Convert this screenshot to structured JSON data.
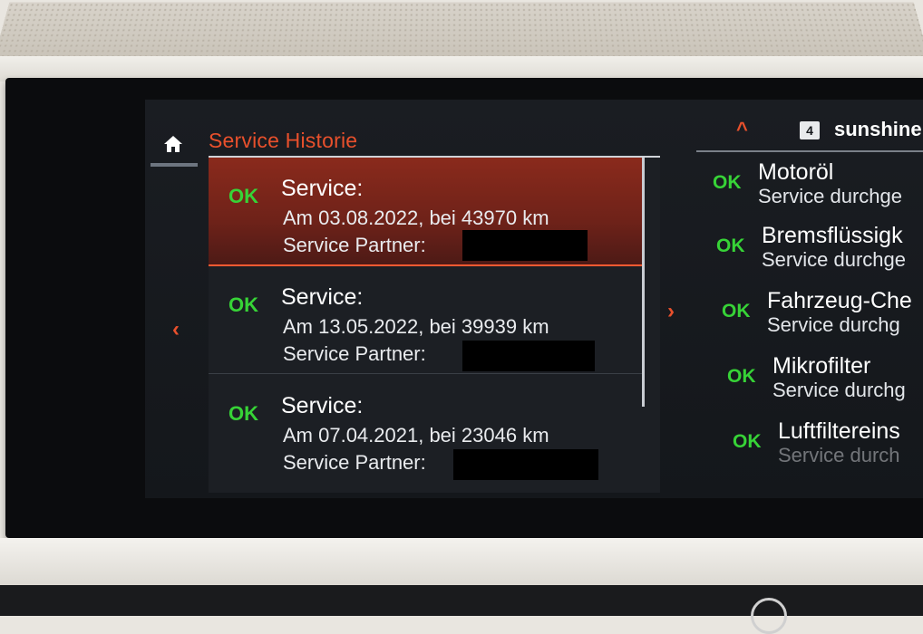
{
  "screen": {
    "panel_title": "Service Historie",
    "nav_left": "‹",
    "nav_right": "›",
    "up_chevron": "^",
    "profile_number": "4",
    "profile_name": "sunshine",
    "history": [
      {
        "status": "OK",
        "title": "Service:",
        "detail": "Am 03.08.2022, bei 43970 km",
        "partner_label": "Service Partner: ",
        "selected": true
      },
      {
        "status": "OK",
        "title": "Service:",
        "detail": "Am 13.05.2022, bei 39939 km",
        "partner_label": "Service Partner: ",
        "selected": false
      },
      {
        "status": "OK",
        "title": "Service:",
        "detail": "Am 07.04.2021, bei 23046 km",
        "partner_label": "Service Partner:",
        "selected": false
      }
    ],
    "checks": [
      {
        "status": "OK",
        "name": "Motoröl",
        "status_text": "Service durchge"
      },
      {
        "status": "OK",
        "name": "Bremsflüssigk",
        "status_text": "Service durchge"
      },
      {
        "status": "OK",
        "name": "Fahrzeug-Che",
        "status_text": "Service durchg"
      },
      {
        "status": "OK",
        "name": "Mikrofilter",
        "status_text": "Service durchg"
      },
      {
        "status": "OK",
        "name": "Luftfiltereins",
        "status_text": "Service durch"
      }
    ]
  },
  "icons": {
    "home": "home-icon",
    "nav_left": "chevron-left-icon",
    "nav_right": "chevron-right-icon",
    "up": "chevron-up-icon"
  },
  "colors": {
    "accent": "#e8502c",
    "ok": "#37d337",
    "selected_row": "#7a2619",
    "screen_bg": "#1a1d22"
  }
}
